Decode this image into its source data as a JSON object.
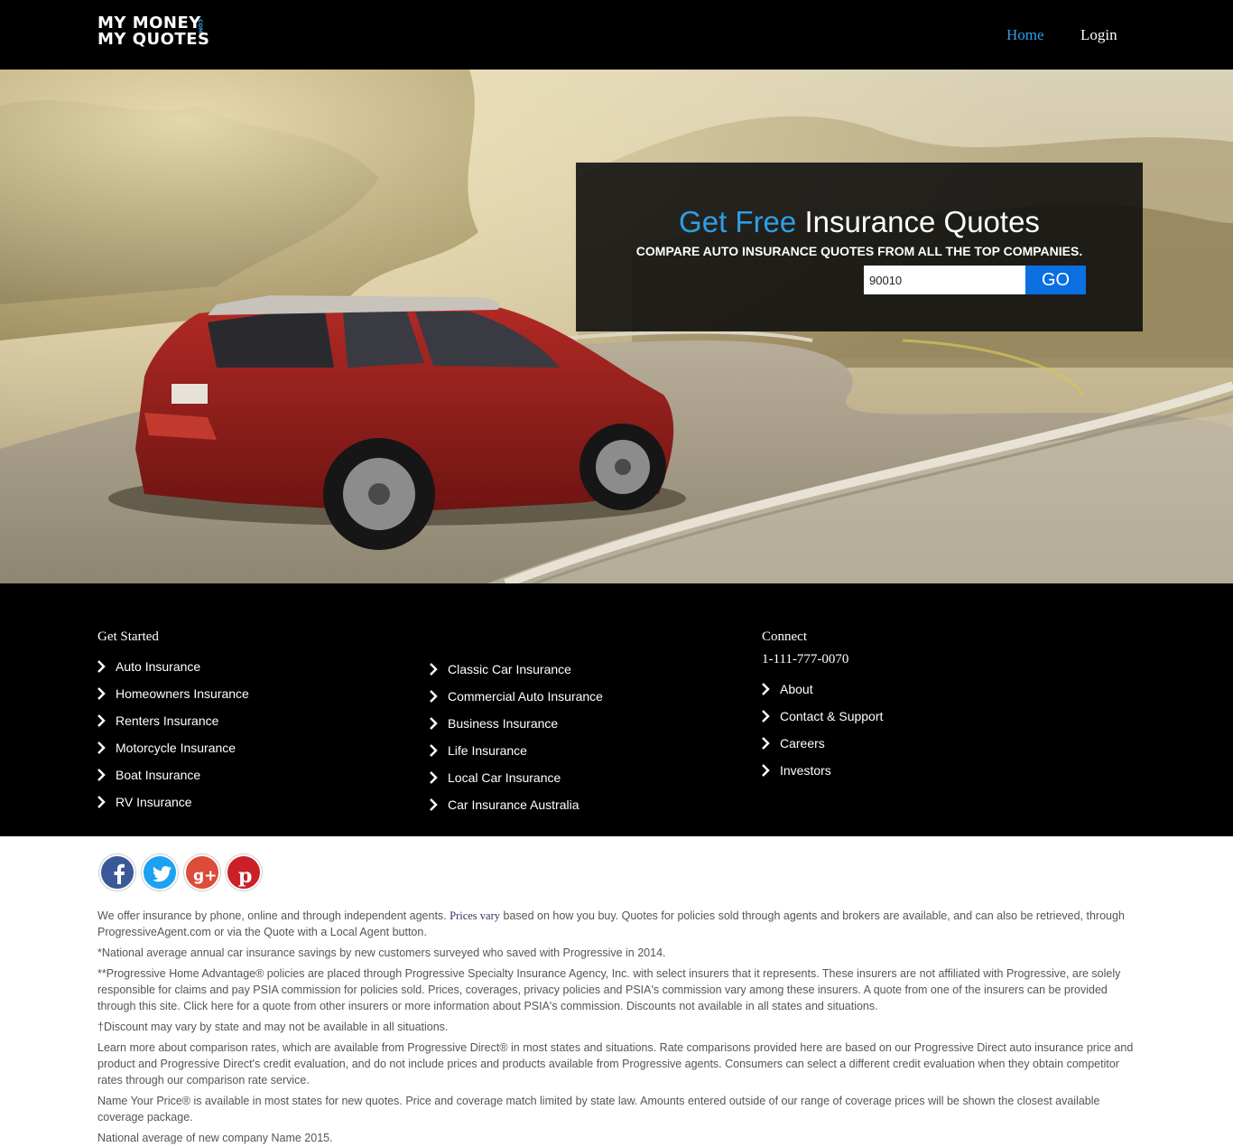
{
  "header": {
    "logo_line1": "MY MONEY",
    "logo_line2": "MY QUOTES",
    "logo_dotcom": ".COM",
    "nav_home": "Home",
    "nav_login": "Login"
  },
  "hero": {
    "title_accent": "Get Free",
    "title_rest": "Insurance Quotes",
    "subtitle": "COMPARE AUTO INSURANCE QUOTES FROM ALL THE TOP COMPANIES.",
    "zip_value": "90010",
    "go_label": "GO"
  },
  "footer": {
    "get_started_heading": "Get Started",
    "col1": [
      "Auto Insurance",
      "Homeowners Insurance",
      "Renters Insurance",
      "Motorcycle Insurance",
      "Boat Insurance",
      "RV Insurance"
    ],
    "col2": [
      "Classic Car Insurance",
      "Commercial Auto Insurance",
      "Business Insurance",
      "Life Insurance",
      "Local Car Insurance",
      "Car Insurance Australia"
    ],
    "connect_heading": "Connect",
    "phone": "1-111-777-0070",
    "col3": [
      "About",
      "Contact & Support",
      "Careers",
      "Investors"
    ]
  },
  "social": [
    "facebook-icon",
    "twitter-icon",
    "google-plus-icon",
    "pinterest-icon"
  ],
  "colors": {
    "accent": "#2d9ee8",
    "go_button": "#0b6fe0",
    "facebook": "#3b5998",
    "twitter": "#1da1f2",
    "google_plus": "#dd4b39",
    "pinterest": "#cb2027"
  },
  "disclaimer": {
    "p1_a": "We offer insurance by phone, online and through independent agents.",
    "p1_b": "Prices vary",
    "p1_c": "based on how you buy. Quotes for policies sold through agents and brokers are available, and can also be retrieved, through ProgressiveAgent.com or via the Quote with a Local Agent button.",
    "p2": "*National average annual car insurance savings by new customers surveyed who saved with Progressive in 2014.",
    "p3": "**Progressive Home Advantage® policies are placed through Progressive Specialty Insurance Agency, Inc. with select insurers that it represents. These insurers are not affiliated with Progressive, are solely responsible for claims and pay PSIA commission for policies sold. Prices, coverages, privacy policies and PSIA's commission vary among these insurers. A quote from one of the insurers can be provided through this site. Click here for a quote from other insurers or more information about PSIA's commission. Discounts not available in all states and situations.",
    "p4": "†Discount may vary by state and may not be available in all situations.",
    "p5": "Learn more about comparison rates, which are available from Progressive Direct® in most states and situations. Rate comparisons provided here are based on our Progressive Direct auto insurance price and product and Progressive Direct's credit evaluation, and do not include prices and products available from Progressive agents. Consumers can select a different credit evaluation when they obtain competitor rates through our comparison rate service.",
    "p6": "Name Your Price® is available in most states for new quotes. Price and coverage match limited by state law. Amounts entered outside of our range of coverage prices will be shown the closest available coverage package.",
    "p7": "National average of new company Name 2015."
  }
}
